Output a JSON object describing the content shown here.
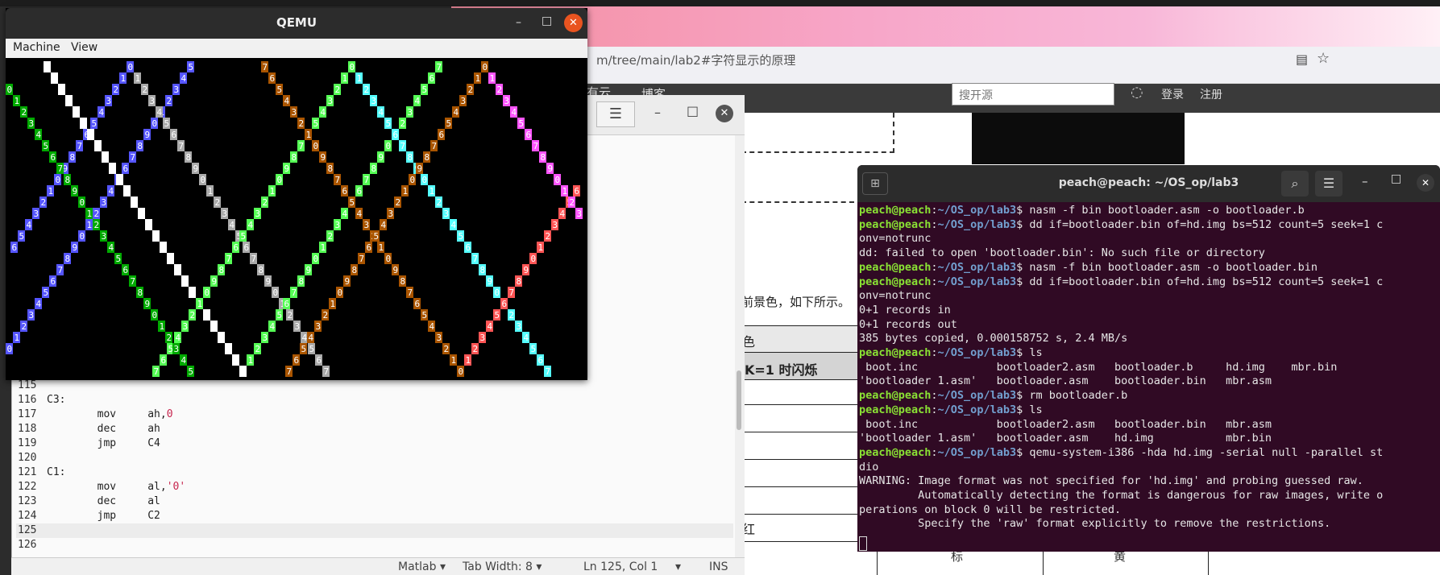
{
  "browser": {
    "url_fragment": "m/tree/main/lab2#字符显示的原理",
    "nav": {
      "item1": "有云",
      "item2": "博客"
    },
    "search_placeholder": "搜开源",
    "login": "登录",
    "register": "注册",
    "body_text": "前景色，如下所示。",
    "table": {
      "r1": "色",
      "r2": "K=1 时闪烁",
      "r3": "红",
      "c_mid": "标",
      "c_right": "黄"
    }
  },
  "qemu": {
    "title": "QEMU",
    "menu": [
      "Machine",
      "View"
    ],
    "pattern": {
      "colors": [
        "#5555ff",
        "#55ff55",
        "#55ffff",
        "#ff5555",
        "#ff55ff",
        "#ffff55",
        "#ffffff",
        "#aaaaaa",
        "#0000aa",
        "#00aa00",
        "#00aaaa",
        "#aa0000",
        "#aa00aa",
        "#aa5500",
        "#555555",
        "#cccc00"
      ],
      "digits": "0123456789"
    }
  },
  "editor": {
    "code": [
      {
        "num": "115",
        "text": ""
      },
      {
        "num": "116",
        "text": "C3:"
      },
      {
        "num": "117",
        "text": "        mov     ah,0"
      },
      {
        "num": "118",
        "text": "        dec     ah"
      },
      {
        "num": "119",
        "text": "        jmp     C4"
      },
      {
        "num": "120",
        "text": ""
      },
      {
        "num": "121",
        "text": "C1:"
      },
      {
        "num": "122",
        "text": "        mov     al,'0'"
      },
      {
        "num": "123",
        "text": "        dec     al"
      },
      {
        "num": "124",
        "text": "        jmp     C2"
      },
      {
        "num": "125",
        "text": ""
      },
      {
        "num": "126",
        "text": ""
      }
    ],
    "status": {
      "lang": "Matlab",
      "tabwidth": "Tab Width: 8",
      "pos": "Ln 125, Col 1",
      "mode": "INS"
    }
  },
  "terminal": {
    "title": "peach@peach: ~/OS_op/lab3",
    "prompt_user": "peach@peach",
    "prompt_path": "~/OS_op/lab3",
    "lines": [
      {
        "p": true,
        "t": "nasm -f bin bootloader.asm -o bootloader.b"
      },
      {
        "p": true,
        "t": "dd if=bootloader.bin of=hd.img bs=512 count=5 seek=1 c"
      },
      {
        "p": false,
        "t": "onv=notrunc"
      },
      {
        "p": false,
        "t": "dd: failed to open 'bootloader.bin': No such file or directory"
      },
      {
        "p": true,
        "t": "nasm -f bin bootloader.asm -o bootloader.bin"
      },
      {
        "p": true,
        "t": "dd if=bootloader.bin of=hd.img bs=512 count=5 seek=1 c"
      },
      {
        "p": false,
        "t": "onv=notrunc"
      },
      {
        "p": false,
        "t": "0+1 records in"
      },
      {
        "p": false,
        "t": "0+1 records out"
      },
      {
        "p": false,
        "t": "385 bytes copied, 0.000158752 s, 2.4 MB/s"
      },
      {
        "p": true,
        "t": "ls"
      },
      {
        "p": false,
        "t": " boot.inc            bootloader2.asm   bootloader.b     hd.img    mbr.bin"
      },
      {
        "p": false,
        "t": "'bootloader 1.asm'   bootloader.asm    bootloader.bin   mbr.asm"
      },
      {
        "p": true,
        "t": "rm bootloader.b"
      },
      {
        "p": true,
        "t": "ls"
      },
      {
        "p": false,
        "t": " boot.inc            bootloader2.asm   bootloader.bin   mbr.asm"
      },
      {
        "p": false,
        "t": "'bootloader 1.asm'   bootloader.asm    hd.img           mbr.bin"
      },
      {
        "p": true,
        "t": "qemu-system-i386 -hda hd.img -serial null -parallel st"
      },
      {
        "p": false,
        "t": "dio"
      },
      {
        "p": false,
        "t": "WARNING: Image format was not specified for 'hd.img' and probing guessed raw."
      },
      {
        "p": false,
        "t": "         Automatically detecting the format is dangerous for raw images, write o"
      },
      {
        "p": false,
        "t": "perations on block 0 will be restricted."
      },
      {
        "p": false,
        "t": "         Specify the 'raw' format explicitly to remove the restrictions."
      }
    ]
  }
}
